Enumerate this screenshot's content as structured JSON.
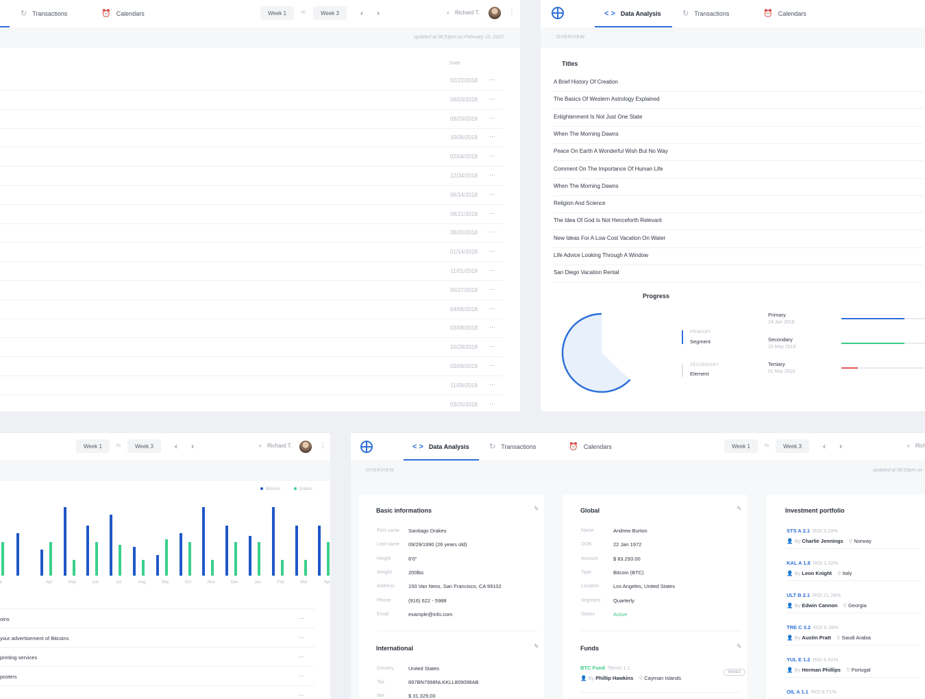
{
  "colors": {
    "accent": "#2d6fd8",
    "green": "#3ac987",
    "red": "#e25555",
    "status_active": "#3ac987"
  },
  "tl": {
    "tabs": [
      {
        "label": "Transactions",
        "icon": "refresh-icon"
      },
      {
        "label": "Calendars",
        "icon": "alarm-clock-icon"
      }
    ],
    "week_from": "Week 1",
    "week_to_sep": "to",
    "week_to": "Week 3",
    "user": "Richard T.",
    "updated": "updated at 08:53pm on February 12, 2022",
    "date_header": "Date",
    "dates": [
      "02/22/2018",
      "09/03/2018",
      "09/23/2018",
      "10/06/2018",
      "02/04/2018",
      "12/24/2018",
      "06/14/2018",
      "08/21/2018",
      "08/20/2018",
      "01/14/2018",
      "11/01/2018",
      "05/27/2018",
      "04/06/2018",
      "03/08/2018",
      "10/28/2018",
      "03/09/2018",
      "11/08/2018",
      "03/25/2018"
    ],
    "more": "···"
  },
  "tr": {
    "tabs": [
      {
        "label": "Data Analysis",
        "icon": "code-icon"
      },
      {
        "label": "Transactions",
        "icon": "refresh-icon"
      },
      {
        "label": "Calendars",
        "icon": "alarm-clock-icon"
      }
    ],
    "overview": "OVERVIEW",
    "titles_header": "Titles",
    "titles": [
      "A Brief History Of Creation",
      "The Basics Of Western Astrology Explained",
      "Enlightenment Is Not Just One State",
      "When The Morning Dawns",
      "Peace On Earth A Wonderful Wish But No Way",
      "Comment On The Importance Of Human Life",
      "When The Morning Dawns",
      "Religion And Science",
      "The Idea Of God Is Not Henceforth Relevant",
      "New Ideas For A Low Cost Vacation On Water",
      "Life Advice Looking Through A Window",
      "San Diego Vacation Rental"
    ],
    "progress_title": "Progress",
    "pie_fraction": 0.37,
    "legend": [
      {
        "small": "PRIMARY",
        "label": "Segment"
      },
      {
        "small": "SECONDARY",
        "label": "Element"
      }
    ],
    "progress_items": [
      {
        "name": "Primary",
        "date": "24 Jan 2018",
        "value": 0.75,
        "color": "#2d6fd8"
      },
      {
        "name": "Secondary",
        "date": "15 May 2018",
        "value": 0.75,
        "color": "#3ac987"
      },
      {
        "name": "Tertiary",
        "date": "01 Mar 2018",
        "value": 0.2,
        "color": "#e25555"
      }
    ]
  },
  "bl": {
    "week_from": "Week 1",
    "week_to_sep": "to",
    "week_to": "Week 3",
    "user": "Richard T.",
    "legend": [
      "Bitcoins",
      "Dollars"
    ],
    "chart_data": {
      "type": "bar",
      "categories": [
        "Mar",
        "Apr",
        "May",
        "Jun",
        "Jul",
        "Aug",
        "Sep",
        "Oct",
        "Nov",
        "Dec",
        "Jan",
        "Feb",
        "Mar",
        "Apr"
      ],
      "series": [
        {
          "name": "Bitcoins",
          "values": [
            62,
            38,
            100,
            73,
            89,
            42,
            30,
            62,
            100,
            73,
            58,
            100,
            73,
            73
          ]
        },
        {
          "name": "Dollars",
          "values": [
            49,
            49,
            23,
            49,
            45,
            23,
            53,
            49,
            23,
            49,
            49,
            23,
            23,
            49
          ]
        }
      ],
      "ylim": [
        0,
        100
      ]
    },
    "rows": [
      "oins",
      "your advertisement of Bitcoins",
      "printing services",
      "posters",
      ""
    ],
    "more": "···"
  },
  "br": {
    "tabs": [
      {
        "label": "Data Analysis",
        "icon": "code-icon"
      },
      {
        "label": "Transactions",
        "icon": "refresh-icon"
      },
      {
        "label": "Calendars",
        "icon": "alarm-clock-icon"
      }
    ],
    "week_from": "Week 1",
    "week_to_sep": "to",
    "week_to": "Week 3",
    "user_partial": "Rich",
    "overview": "OVERVIEW",
    "updated": "updated at 08:53pm on",
    "basic": {
      "title": "Basic informations",
      "fields": [
        {
          "label": "First name",
          "value": "Santiago Drakes"
        },
        {
          "label": "Last name",
          "value": "09/29/1990 (26 years old)"
        },
        {
          "label": "Height",
          "value": "6'0\""
        },
        {
          "label": "Weight",
          "value": "200lbs"
        },
        {
          "label": "Address",
          "value": "150 Van Ness, San Francisco, CA 99102"
        },
        {
          "label": "Phone",
          "value": "(916) 622 - 5988"
        },
        {
          "label": "Email",
          "value": "example@info.com"
        }
      ]
    },
    "international": {
      "title": "International",
      "fields": [
        {
          "label": "Country",
          "value": "United States"
        },
        {
          "label": "Tax",
          "value": "897BN7998NLKKLL809098AB"
        },
        {
          "label": "Net",
          "value": "$ 31.329,00"
        }
      ]
    },
    "global": {
      "title": "Global",
      "fields": [
        {
          "label": "Name",
          "value": "Andrew Burton"
        },
        {
          "label": "DOB",
          "value": "22 Jan 1972"
        },
        {
          "label": "Amount",
          "value": "$ 83.293.00"
        },
        {
          "label": "Type",
          "value": "Bitcoin (BTC)"
        },
        {
          "label": "Location",
          "value": "Los Angeles, United States"
        },
        {
          "label": "Segment",
          "value": "Quarterly"
        },
        {
          "label": "Status",
          "value": "Active"
        }
      ]
    },
    "funds": {
      "title": "Funds",
      "item": {
        "code": "BTC Fund",
        "terms": "Terms 1.1",
        "by": "By",
        "person": "Phillip Hawkins",
        "location": "Cayman Islands",
        "badge": "BASES"
      }
    },
    "portfolio": {
      "title": "Investment portfolio",
      "items": [
        {
          "code": "STS A 2.1",
          "roi": "ROI 3.29%",
          "by": "By",
          "person": "Charlie Jennings",
          "location": "Norway"
        },
        {
          "code": "KAL A 1.8",
          "roi": "ROI 1.32%",
          "by": "By",
          "person": "Leon Knight",
          "location": "Italy"
        },
        {
          "code": "ULT B 2.1",
          "roi": "ROI 21.28%",
          "by": "By",
          "person": "Edwin Cannon",
          "location": "Georgia"
        },
        {
          "code": "TRE C 3.2",
          "roi": "ROI 9.18%",
          "by": "By",
          "person": "Austin Pratt",
          "location": "Saudi Arabia"
        },
        {
          "code": "YUL E 1.2",
          "roi": "ROI 4.41%",
          "by": "By",
          "person": "Herman Phillips",
          "location": "Portugal"
        },
        {
          "code": "OIL A 1.1",
          "roi": "ROI 8.71%",
          "by": "",
          "person": "",
          "location": ""
        }
      ]
    }
  }
}
